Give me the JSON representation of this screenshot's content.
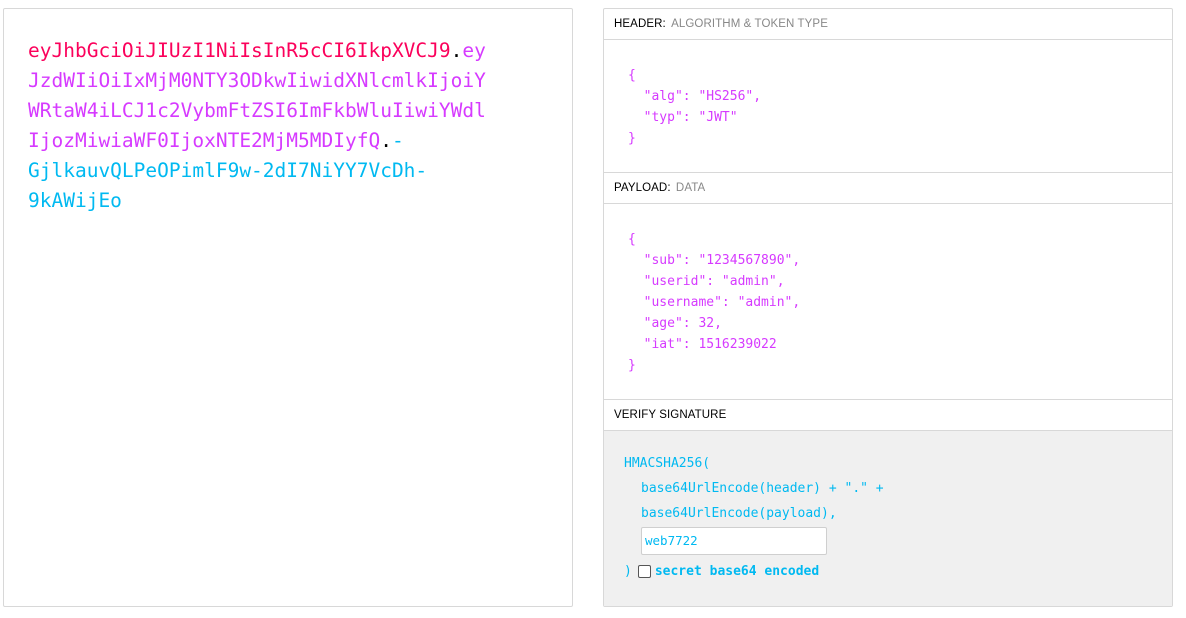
{
  "encoded": {
    "lines": [
      [
        {
          "t": "eyJhbGciOiJIUzI1NiIsInR5cCI6IkpXVCJ9",
          "c": "c-header"
        },
        {
          "t": ".",
          "c": "c-dot"
        },
        {
          "t": "ey",
          "c": "c-payload"
        }
      ],
      [
        {
          "t": "JzdWIiOiIxMjM0NTY3ODkwIiwidXNlcmlkIjoiY",
          "c": "c-payload"
        }
      ],
      [
        {
          "t": "WRtaW4iLCJ1c2VybmFtZSI6ImFkbWluIiwiYWdl",
          "c": "c-payload"
        }
      ],
      [
        {
          "t": "IjozMiwiaWF0IjoxNTE2MjM5MDIyfQ",
          "c": "c-payload"
        },
        {
          "t": ".",
          "c": "c-dot"
        },
        {
          "t": "-",
          "c": "c-sig"
        }
      ],
      [
        {
          "t": "GjlkauvQLPeOPimlF9w-2dI7NiYY7VcDh-",
          "c": "c-sig"
        }
      ],
      [
        {
          "t": "9kAWijEo",
          "c": "c-sig"
        }
      ]
    ]
  },
  "header_section": {
    "title": "HEADER:",
    "subtitle": "ALGORITHM & TOKEN TYPE",
    "json_lines": [
      "{",
      "  \"alg\": \"HS256\",",
      "  \"typ\": \"JWT\"",
      "}"
    ]
  },
  "payload_section": {
    "title": "PAYLOAD:",
    "subtitle": "DATA",
    "json_lines": [
      "{",
      "  \"sub\": \"1234567890\",",
      "  \"userid\": \"admin\",",
      "  \"username\": \"admin\",",
      "  \"age\": 32,",
      "  \"iat\": 1516239022",
      "}"
    ]
  },
  "verify_section": {
    "title": "VERIFY SIGNATURE",
    "fn_open": "HMACSHA256(",
    "line_header": "base64UrlEncode(header) + \".\" +",
    "line_payload": "base64UrlEncode(payload),",
    "secret_value": "web7722",
    "close_paren": ")",
    "checkbox_label": "secret base64 encoded",
    "checkbox_checked": false
  },
  "colors": {
    "header": "#fb015b",
    "payload": "#d63aff",
    "signature": "#00b9f1",
    "verify_bg": "#f0f0f0"
  }
}
